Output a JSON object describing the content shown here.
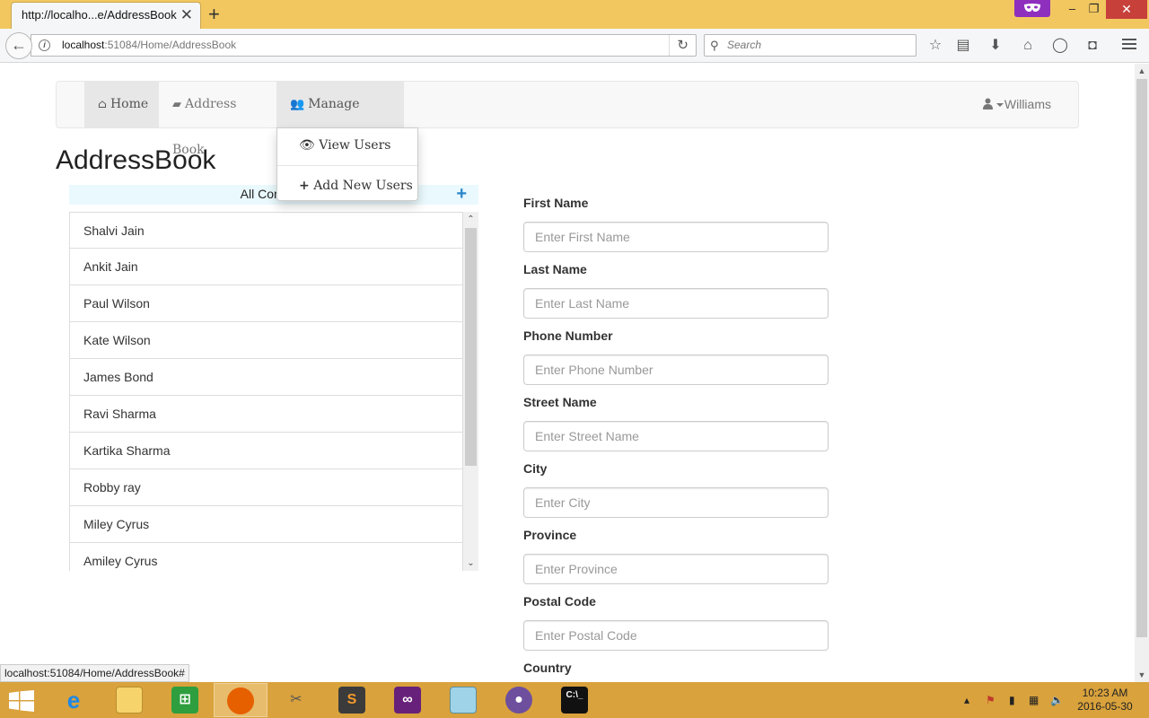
{
  "browser": {
    "tab_title": "http://localho...e/AddressBook",
    "tab_close": "✕",
    "new_tab": "+",
    "url_host": "localhost",
    "url_rest": ":51084/Home/AddressBook",
    "search_placeholder": "Search",
    "status_bar_link": "localhost:51084/Home/AddressBook#"
  },
  "window_controls": {
    "minimize": "–",
    "maximize": "❐",
    "close": "✕"
  },
  "app_nav": {
    "home": "Home",
    "address_book": "Address Book",
    "manage_users": "Manage Users",
    "user_name": "Williams"
  },
  "manage_users_menu": {
    "view_users": "View Users",
    "add_new_users": "Add New Users"
  },
  "page": {
    "title": "AddressBook",
    "contacts_header": "All Contacts",
    "contacts": [
      "Shalvi Jain",
      "Ankit Jain",
      "Paul Wilson",
      "Kate Wilson",
      "James Bond",
      "Ravi Sharma",
      "Kartika Sharma",
      "Robby ray",
      "Miley Cyrus",
      "Amiley Cyrus"
    ]
  },
  "form": {
    "first_name": {
      "label": "First Name",
      "placeholder": "Enter First Name"
    },
    "last_name": {
      "label": "Last Name",
      "placeholder": "Enter Last Name"
    },
    "phone_number": {
      "label": "Phone Number",
      "placeholder": "Enter Phone Number"
    },
    "street_name": {
      "label": "Street Name",
      "placeholder": "Enter Street Name"
    },
    "city": {
      "label": "City",
      "placeholder": "Enter City"
    },
    "province": {
      "label": "Province",
      "placeholder": "Enter Province"
    },
    "postal_code": {
      "label": "Postal Code",
      "placeholder": "Enter Postal Code"
    },
    "country": {
      "label": "Country"
    }
  },
  "taskbar": {
    "apps": [
      "start",
      "internet-explorer",
      "file-explorer",
      "windows-store",
      "firefox",
      "tools",
      "sublime-text",
      "visual-studio",
      "notepad",
      "github",
      "command-prompt"
    ],
    "time": "10:23 AM",
    "date": "2016-05-30"
  },
  "colors": {
    "browser_titlebar": "#f2c760",
    "taskbar": "#d9a23c",
    "contacts_header_bg": "#eaf9fd",
    "add_icon": "#2a86c8",
    "private_badge": "#8e2fbe"
  }
}
